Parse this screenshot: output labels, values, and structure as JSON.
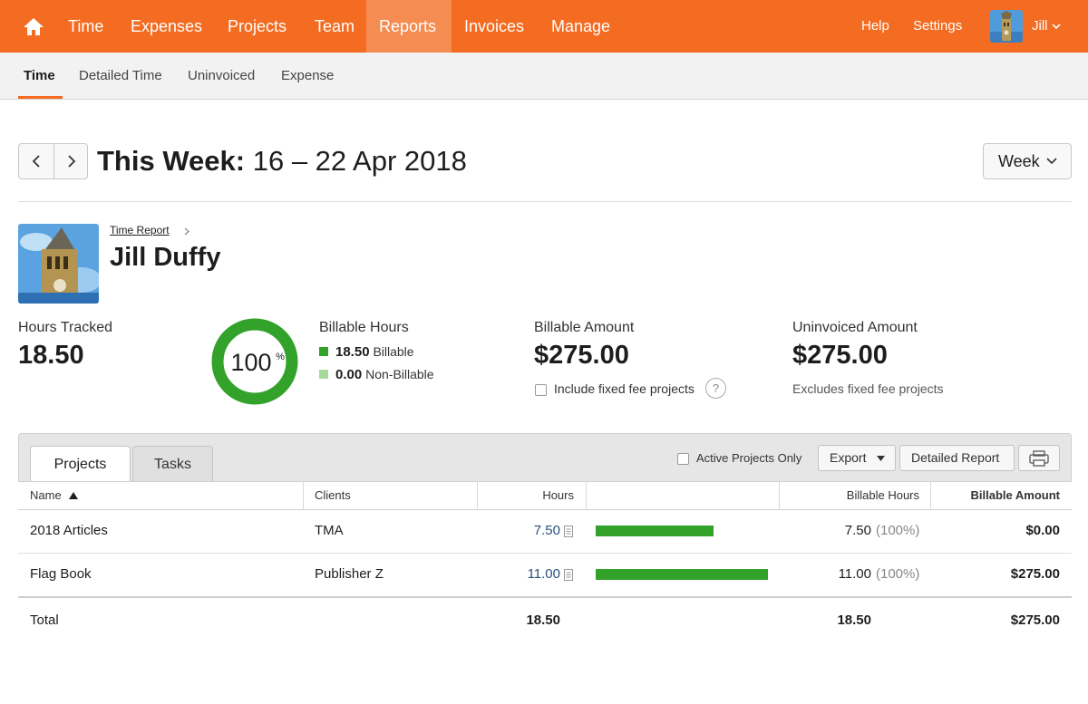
{
  "nav": {
    "items": [
      "Time",
      "Expenses",
      "Projects",
      "Team",
      "Reports",
      "Invoices",
      "Manage"
    ],
    "active": "Reports",
    "help": "Help",
    "settings": "Settings",
    "user": "Jill",
    "accent": "#f36c21"
  },
  "subnav": {
    "items": [
      "Time",
      "Detailed Time",
      "Uninvoiced",
      "Expense"
    ],
    "active": "Time"
  },
  "header": {
    "title_prefix": "This Week:",
    "title_range": "16 – 22 Apr 2018",
    "period_button": "Week"
  },
  "person": {
    "breadcrumb": "Time Report",
    "name": "Jill Duffy"
  },
  "summary": {
    "hours_tracked_label": "Hours Tracked",
    "hours_tracked": "18.50",
    "donut_percent": "100",
    "donut_percent_sign": "%",
    "donut_fraction": 1.0,
    "billable_hours_label": "Billable Hours",
    "billable_value": "18.50",
    "billable_word": "Billable",
    "nonbillable_value": "0.00",
    "nonbillable_word": "Non-Billable",
    "billable_color": "#33a22b",
    "nonbillable_color": "#a6d99b",
    "billable_amount_label": "Billable Amount",
    "billable_amount": "$275.00",
    "fixed_fee_checkbox": "Include fixed fee projects",
    "help_glyph": "?",
    "uninvoiced_label": "Uninvoiced Amount",
    "uninvoiced_amount": "$275.00",
    "uninvoiced_note": "Excludes fixed fee projects"
  },
  "table": {
    "tabs": [
      "Projects",
      "Tasks"
    ],
    "active_tab": "Projects",
    "active_only_label": "Active Projects Only",
    "export_label": "Export",
    "detailed_report_label": "Detailed Report",
    "columns": {
      "name": "Name",
      "clients": "Clients",
      "hours": "Hours",
      "billable_hours": "Billable Hours",
      "billable_amount": "Billable Amount"
    },
    "rows": [
      {
        "name": "2018 Articles",
        "client": "TMA",
        "hours": "7.50",
        "hours_value": 7.5,
        "billable_hours": "7.50",
        "billable_pct": "(100%)",
        "amount": "$0.00"
      },
      {
        "name": "Flag Book",
        "client": "Publisher Z",
        "hours": "11.00",
        "hours_value": 11.0,
        "billable_hours": "11.00",
        "billable_pct": "(100%)",
        "amount": "$275.00"
      }
    ],
    "total": {
      "label": "Total",
      "hours": "18.50",
      "billable_hours": "18.50",
      "amount": "$275.00"
    }
  }
}
